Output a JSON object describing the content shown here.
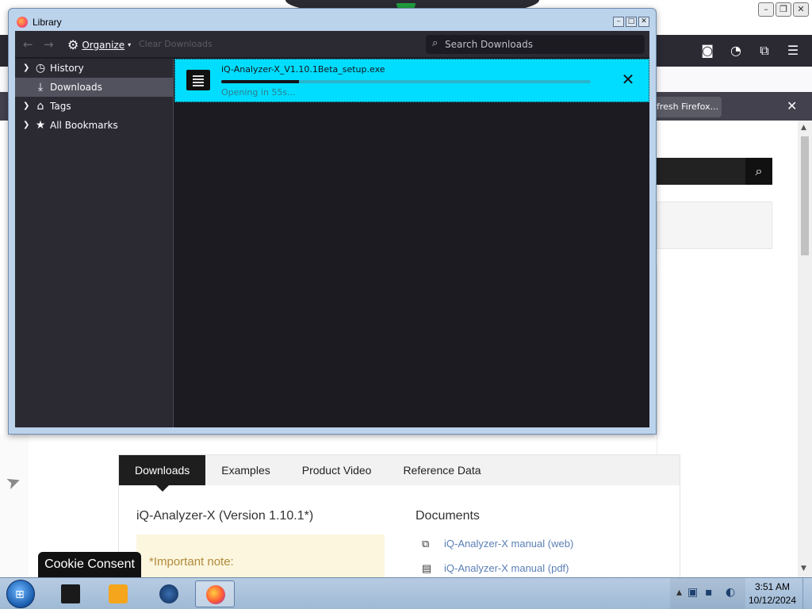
{
  "colors": {
    "accent": "#00ddff",
    "window_frame": "#bcd3ec",
    "dark_bg": "#1c1b22",
    "sidebar_bg": "#2b2a33"
  },
  "browser": {
    "notification": {
      "refresh_label": "fresh Firefox..."
    }
  },
  "library": {
    "title": "Library",
    "toolbar": {
      "organize_label": "Organize",
      "clear_label": "Clear Downloads",
      "search_placeholder": "Search Downloads"
    },
    "sidebar": {
      "items": [
        {
          "label": "History",
          "icon": "clock-icon"
        },
        {
          "label": "Downloads",
          "icon": "download-icon"
        },
        {
          "label": "Tags",
          "icon": "tag-icon"
        },
        {
          "label": "All Bookmarks",
          "icon": "star-icon"
        }
      ]
    },
    "download": {
      "filename": "iQ-Analyzer-X_V1.10.1Beta_setup.exe",
      "status": "Opening in 55s...",
      "progress": 0.21
    }
  },
  "page": {
    "tabs": [
      "Downloads",
      "Examples",
      "Product Video",
      "Reference Data"
    ],
    "product_heading": "iQ-Analyzer-X (Version 1.10.1*)",
    "note": "*Important note:",
    "documents_heading": "Documents",
    "doc_links": [
      "iQ-Analyzer-X manual (web)",
      "iQ-Analyzer-X manual (pdf)"
    ]
  },
  "cookie_label": "Cookie Consent",
  "taskbar": {
    "time": "3:51 AM",
    "date": "10/12/2024"
  }
}
